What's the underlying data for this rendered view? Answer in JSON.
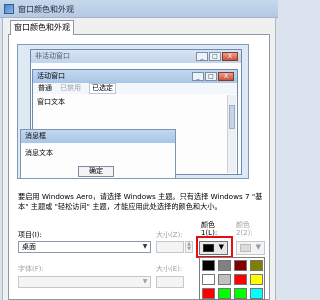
{
  "window": {
    "title": "窗口颜色和外观"
  },
  "tab": {
    "label": "窗口颜色和外观"
  },
  "preview": {
    "inactive_window_title": "非活动窗口",
    "active_window_title": "活动窗口",
    "menu": [
      "普通",
      "已禁用",
      "已选定"
    ],
    "window_text": "窗口文本",
    "message_box_title": "消息框",
    "message_text": "消息文本",
    "ok_button": "确定",
    "close_glyph": "X",
    "min_glyph": "_",
    "max_glyph": "□"
  },
  "description": "要启用 Windows Aero，请选择 Windows 主题。只有选择 Windows 7 \"基本\" 主题或 \"轻松访问\" 主题，才能应用此处选择的颜色和大小。",
  "labels": {
    "item": "项目(I):",
    "size": "大小(Z):",
    "color1": "颜色",
    "color1_sub": "1(L):",
    "color2": "颜色",
    "color2_sub": "2(2):",
    "font": "字体(F):",
    "font_size": "大小(E):"
  },
  "item_combo": {
    "value": "桌面"
  },
  "palette_colors": [
    "#000000",
    "#808080",
    "#800000",
    "#808000",
    "#ffffff",
    "#c0c0c0",
    "#ff0000",
    "#ffff00",
    "#008000",
    "#00ff00",
    "#00ff00",
    "#00ffff"
  ],
  "colors": {
    "selected_color1": "#000000",
    "highlight": "#e01010"
  },
  "icons": {
    "combo_arrow": "▼",
    "spin_up": "▲",
    "spin_down": "▼"
  }
}
